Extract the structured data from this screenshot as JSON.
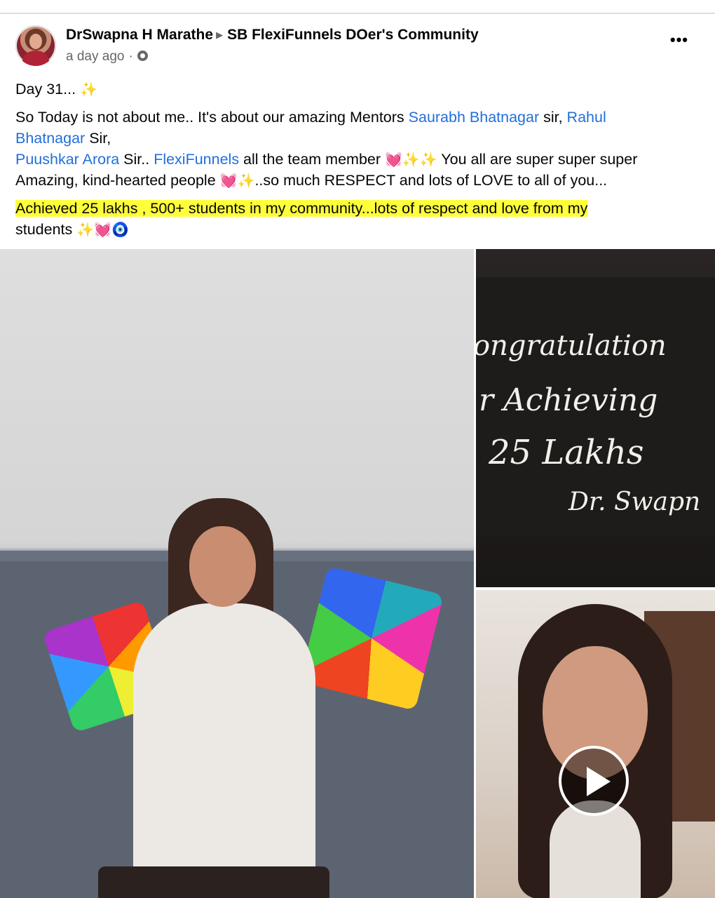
{
  "post": {
    "author": "DrSwapna H Marathe",
    "group": "SB FlexiFunnels DOer's Community",
    "time": "a day ago",
    "more_label": "•••",
    "line1": "Day 31...",
    "line1_emoji": "✨",
    "p2_a": "So Today is not about me.. It's about our amazing Mentors ",
    "mention_saurabh": "Saurabh Bhatnagar",
    "p2_b": "  sir, ",
    "mention_rahul_1": "Rahul",
    "mention_rahul_2": "Bhatnagar",
    "p2_c": "  Sir,",
    "mention_puushkar": "Puushkar Arora",
    "p3_a": " Sir.. ",
    "mention_flexi": "FlexiFunnels",
    "p3_b": " all the team member ",
    "p3_emoji": "💓✨✨",
    "p3_c": " You all are super super super",
    "p4_a": "Amazing, kind-hearted people ",
    "p4_emoji": "💓✨",
    "p4_b": "..so much RESPECT and lots of LOVE to all of you...",
    "highlight_line": "Achieved 25 lakhs , 500+ students in my community...lots of respect and love from my",
    "last_a": "students ",
    "last_emoji": "✨💓🧿"
  },
  "cake_photo": {
    "line1": "ongratulation",
    "line2": "r Achieving",
    "line3": "25 Lakhs",
    "line4": "Dr. Swapn"
  }
}
